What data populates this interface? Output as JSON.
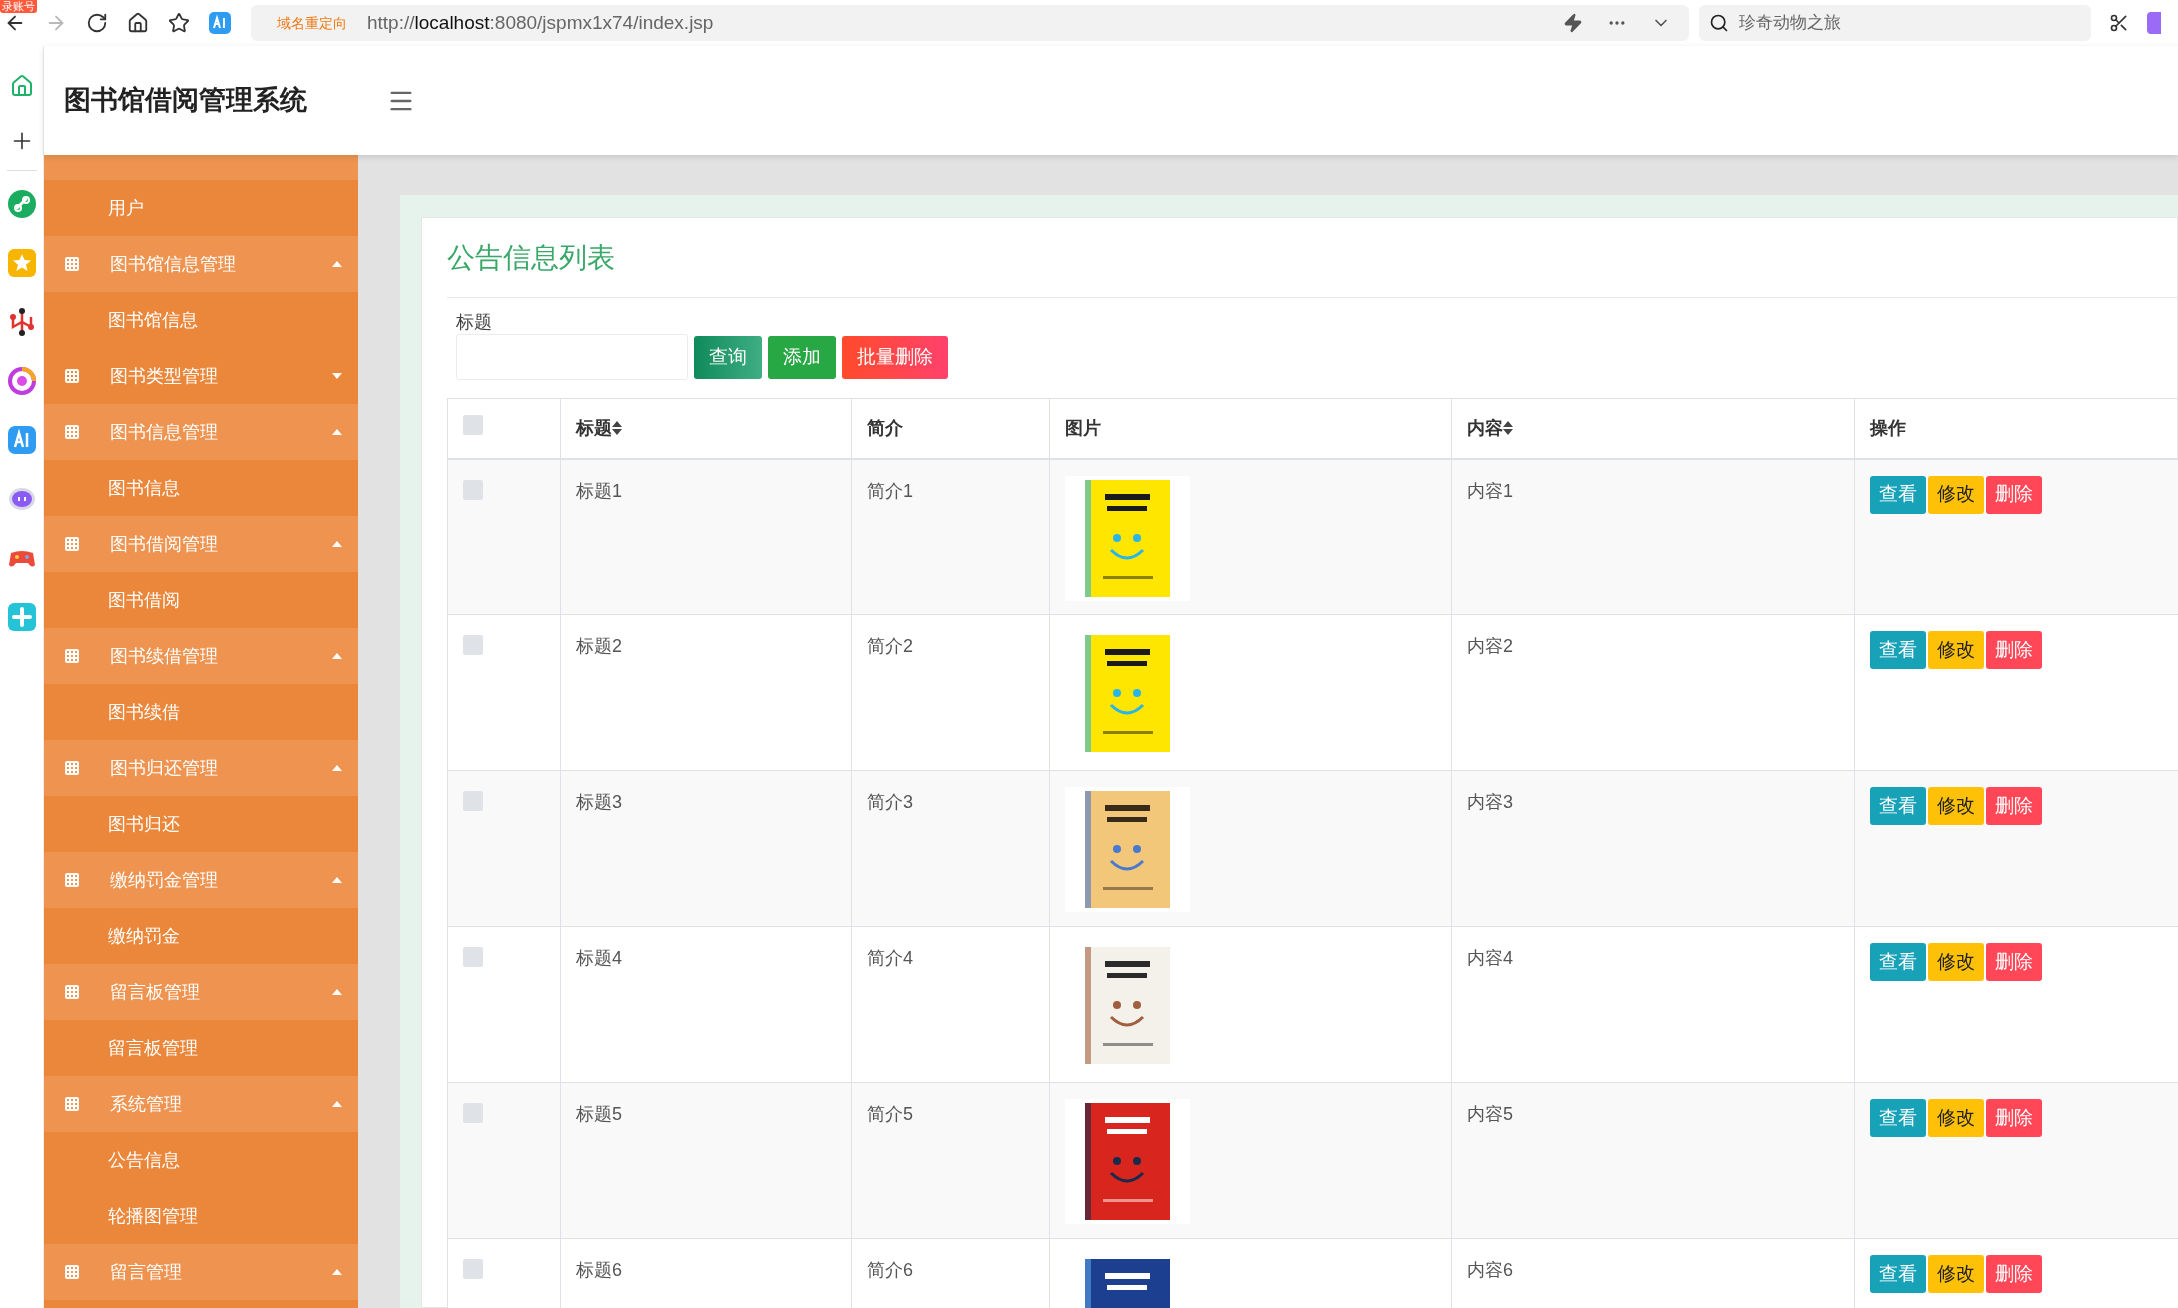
{
  "browser": {
    "badge": "录账号",
    "nav": [
      {
        "kind": "back",
        "disabled": false
      },
      {
        "kind": "forward",
        "disabled": true
      },
      {
        "kind": "reload",
        "disabled": false
      },
      {
        "kind": "home",
        "disabled": false
      },
      {
        "kind": "favorites",
        "disabled": false
      }
    ],
    "redirect_label": "域名重定向",
    "address_prefix": "http://",
    "address_host": "localhost",
    "address_rest": ":8080/jspmx1x74/index.jsp",
    "search_placeholder": "珍奇动物之旅"
  },
  "app": {
    "title": "图书馆借阅管理系统"
  },
  "sidebar": {
    "groups": [
      {
        "expanded": true,
        "children": [
          {
            "label": "用户"
          }
        ]
      },
      {
        "label": "图书馆信息管理",
        "expanded": true,
        "children": [
          {
            "label": "图书馆信息"
          }
        ]
      },
      {
        "label": "图书类型管理",
        "expanded": false
      },
      {
        "label": "图书信息管理",
        "expanded": true,
        "children": [
          {
            "label": "图书信息"
          }
        ]
      },
      {
        "label": "图书借阅管理",
        "expanded": true,
        "children": [
          {
            "label": "图书借阅"
          }
        ]
      },
      {
        "label": "图书续借管理",
        "expanded": true,
        "children": [
          {
            "label": "图书续借"
          }
        ]
      },
      {
        "label": "图书归还管理",
        "expanded": true,
        "children": [
          {
            "label": "图书归还"
          }
        ]
      },
      {
        "label": "缴纳罚金管理",
        "expanded": true,
        "children": [
          {
            "label": "缴纳罚金"
          }
        ]
      },
      {
        "label": "留言板管理",
        "expanded": true,
        "children": [
          {
            "label": "留言板管理"
          }
        ]
      },
      {
        "label": "系统管理",
        "expanded": true,
        "children": [
          {
            "label": "公告信息"
          },
          {
            "label": "轮播图管理"
          }
        ]
      },
      {
        "label": "留言管理",
        "expanded": true
      }
    ]
  },
  "panel": {
    "title": "公告信息列表",
    "search": {
      "label": "标题"
    },
    "buttons": [
      {
        "label": "查询",
        "kind": "query"
      },
      {
        "label": "添加",
        "kind": "add"
      },
      {
        "label": "批量删除",
        "kind": "delete"
      }
    ],
    "table": {
      "select_all": {
        "checked": false
      },
      "columns": [
        {
          "label": "标题",
          "sortable": true
        },
        {
          "label": "简介",
          "sortable": false
        },
        {
          "label": "图片",
          "sortable": false
        },
        {
          "label": "内容",
          "sortable": true
        },
        {
          "label": "操作",
          "sortable": false
        }
      ],
      "rows": [
        {
          "checked": false,
          "title": "标题1",
          "intro": "简介1",
          "content": "内容1",
          "actions": [
            {
              "label": "查看",
              "kind": "view"
            },
            {
              "label": "修改",
              "kind": "edit"
            },
            {
              "label": "删除",
              "kind": "delete"
            }
          ]
        },
        {
          "checked": false,
          "title": "标题2",
          "intro": "简介2",
          "content": "内容2",
          "actions": [
            {
              "label": "查看",
              "kind": "view"
            },
            {
              "label": "修改",
              "kind": "edit"
            },
            {
              "label": "删除",
              "kind": "delete"
            }
          ]
        },
        {
          "checked": false,
          "title": "标题3",
          "intro": "简介3",
          "content": "内容3",
          "actions": [
            {
              "label": "查看",
              "kind": "view"
            },
            {
              "label": "修改",
              "kind": "edit"
            },
            {
              "label": "删除",
              "kind": "delete"
            }
          ]
        },
        {
          "checked": false,
          "title": "标题4",
          "intro": "简介4",
          "content": "内容4",
          "actions": [
            {
              "label": "查看",
              "kind": "view"
            },
            {
              "label": "修改",
              "kind": "edit"
            },
            {
              "label": "删除",
              "kind": "delete"
            }
          ]
        },
        {
          "checked": false,
          "title": "标题5",
          "intro": "简介5",
          "content": "内容5",
          "actions": [
            {
              "label": "查看",
              "kind": "view"
            },
            {
              "label": "修改",
              "kind": "edit"
            },
            {
              "label": "删除",
              "kind": "delete"
            }
          ]
        },
        {
          "checked": false,
          "title": "标题6",
          "intro": "简介6",
          "content": "内容6",
          "actions": [
            {
              "label": "查看",
              "kind": "view"
            },
            {
              "label": "修改",
              "kind": "edit"
            },
            {
              "label": "删除",
              "kind": "delete"
            }
          ]
        }
      ]
    }
  }
}
